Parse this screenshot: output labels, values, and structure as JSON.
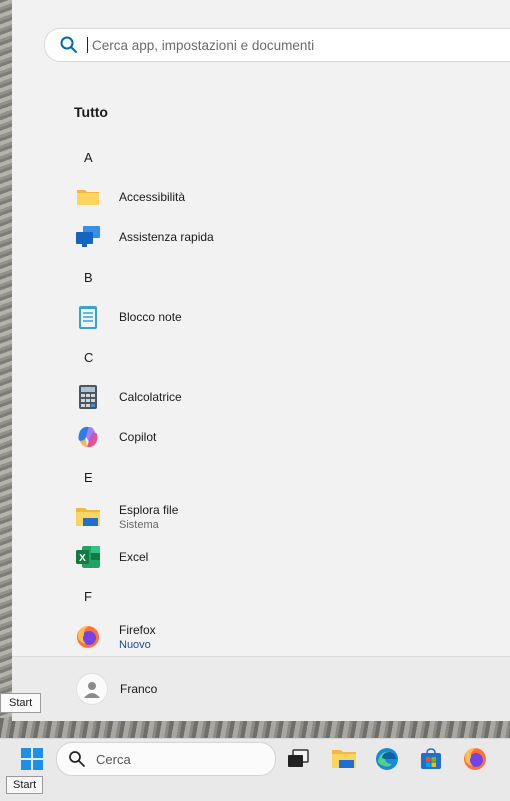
{
  "search": {
    "placeholder": "Cerca app, impostazioni e documenti"
  },
  "section_title": "Tutto",
  "letters": {
    "a": "A",
    "b": "B",
    "c": "C",
    "e": "E",
    "f": "F"
  },
  "apps": [
    {
      "name": "Accessibilità",
      "icon": "folder-icon"
    },
    {
      "name": "Assistenza rapida",
      "icon": "quick-assist-icon"
    },
    {
      "name": "Blocco note",
      "icon": "notepad-icon"
    },
    {
      "name": "Calcolatrice",
      "icon": "calculator-icon"
    },
    {
      "name": "Copilot",
      "icon": "copilot-icon"
    },
    {
      "name": "Esplora file",
      "sub": "Sistema",
      "icon": "file-explorer-icon"
    },
    {
      "name": "Excel",
      "icon": "excel-icon"
    },
    {
      "name": "Firefox",
      "sub": "Nuovo",
      "icon": "firefox-icon"
    }
  ],
  "user": {
    "name": "Franco"
  },
  "tooltips": {
    "start_menu": "Start",
    "taskbar": "Start"
  },
  "taskbar": {
    "search_label": "Cerca",
    "icons": [
      "start-icon",
      "task-view-icon",
      "file-explorer-icon",
      "edge-icon",
      "store-icon",
      "firefox-icon"
    ]
  },
  "colors": {
    "accent": "#0067c0",
    "new_badge": "#1c4aa0",
    "menu_bg": "#f2f2f2"
  }
}
